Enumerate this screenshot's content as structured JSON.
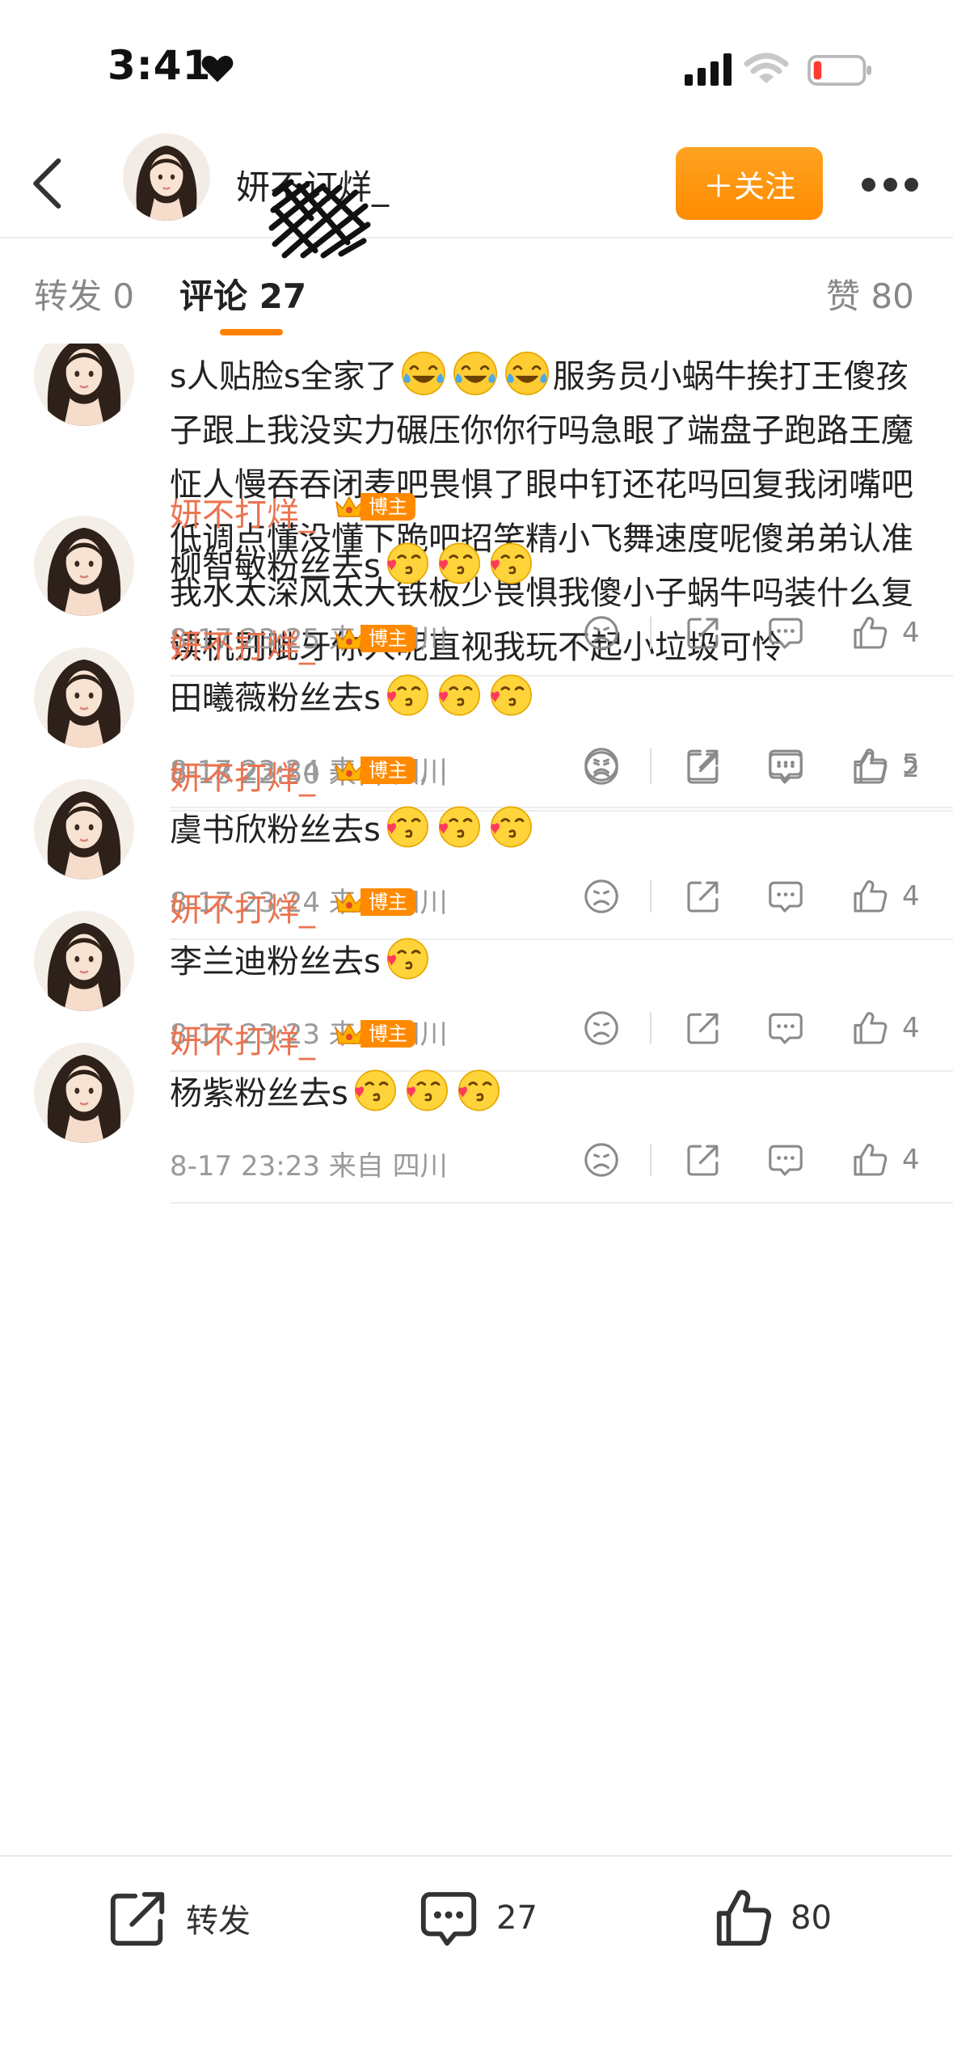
{
  "status_bar": {
    "time": "3:41"
  },
  "header": {
    "username": "妍不订烊_",
    "follow_label": "＋关注"
  },
  "tabs": {
    "repost": "转发 0",
    "comments": "评论 27",
    "likes": "赞 80"
  },
  "comments": [
    {
      "name": "妍不打烊_",
      "badge": "博主",
      "text": "s人贴脸s全家了",
      "emoji_after_text": [
        "laugh-cry",
        "laugh-cry",
        "laugh-cry"
      ],
      "text_continued": "服务员小蜗牛挨打王傻孩子跟上我没实力碾压你你行吗急眼了端盘子跑路王魔怔人慢吞吞闭麦吧畏惧了眼中钉还花吗回复我闭嘴吧低调点懂没懂下跪吧招笑精小飞舞速度呢傻弟弟认准我水太深风太大铁板少畏惧我傻小子蜗牛吗装什么复读机别呲牙你人呢直视我玩不起小垃圾可怜",
      "time": "8-18 22:50",
      "location": "来自 四川",
      "likes": "2"
    },
    {
      "name": "妍不打烊_",
      "badge": "博主",
      "text": "柳智敏粉丝去s",
      "emoji_after_text": [
        "kiss",
        "kiss",
        "kiss"
      ],
      "time": "8-17 23:25",
      "location": "来自 四川",
      "likes": "4"
    },
    {
      "name": "妍不打烊_",
      "badge": "博主",
      "text": "田曦薇粉丝去s",
      "emoji_after_text": [
        "kiss",
        "kiss",
        "kiss"
      ],
      "time": "8-17 23:24",
      "location": "来自 四川",
      "likes": "5"
    },
    {
      "name": "妍不打烊_",
      "badge": "博主",
      "text": "虞书欣粉丝去s",
      "emoji_after_text": [
        "kiss",
        "kiss",
        "kiss"
      ],
      "time": "8-17 23:24",
      "location": "来自 四川",
      "likes": "4"
    },
    {
      "name": "妍不打烊_",
      "badge": "博主",
      "text": "李兰迪粉丝去s",
      "emoji_after_text": [
        "kiss"
      ],
      "time": "8-17 23:23",
      "location": "来自 四川",
      "likes": "4"
    },
    {
      "name": "妍不打烊_",
      "badge": "博主",
      "text": "杨紫粉丝去s",
      "emoji_after_text": [
        "kiss",
        "kiss",
        "kiss"
      ],
      "time": "8-17 23:23",
      "location": "来自 四川",
      "likes": "4"
    }
  ],
  "bottom_bar": {
    "repost_label": "转发",
    "comment_count": "27",
    "like_count": "80"
  },
  "colors": {
    "accent_orange": "#ff8200",
    "username_orange": "#eb7350",
    "meta_gray": "#9a9a9a"
  }
}
